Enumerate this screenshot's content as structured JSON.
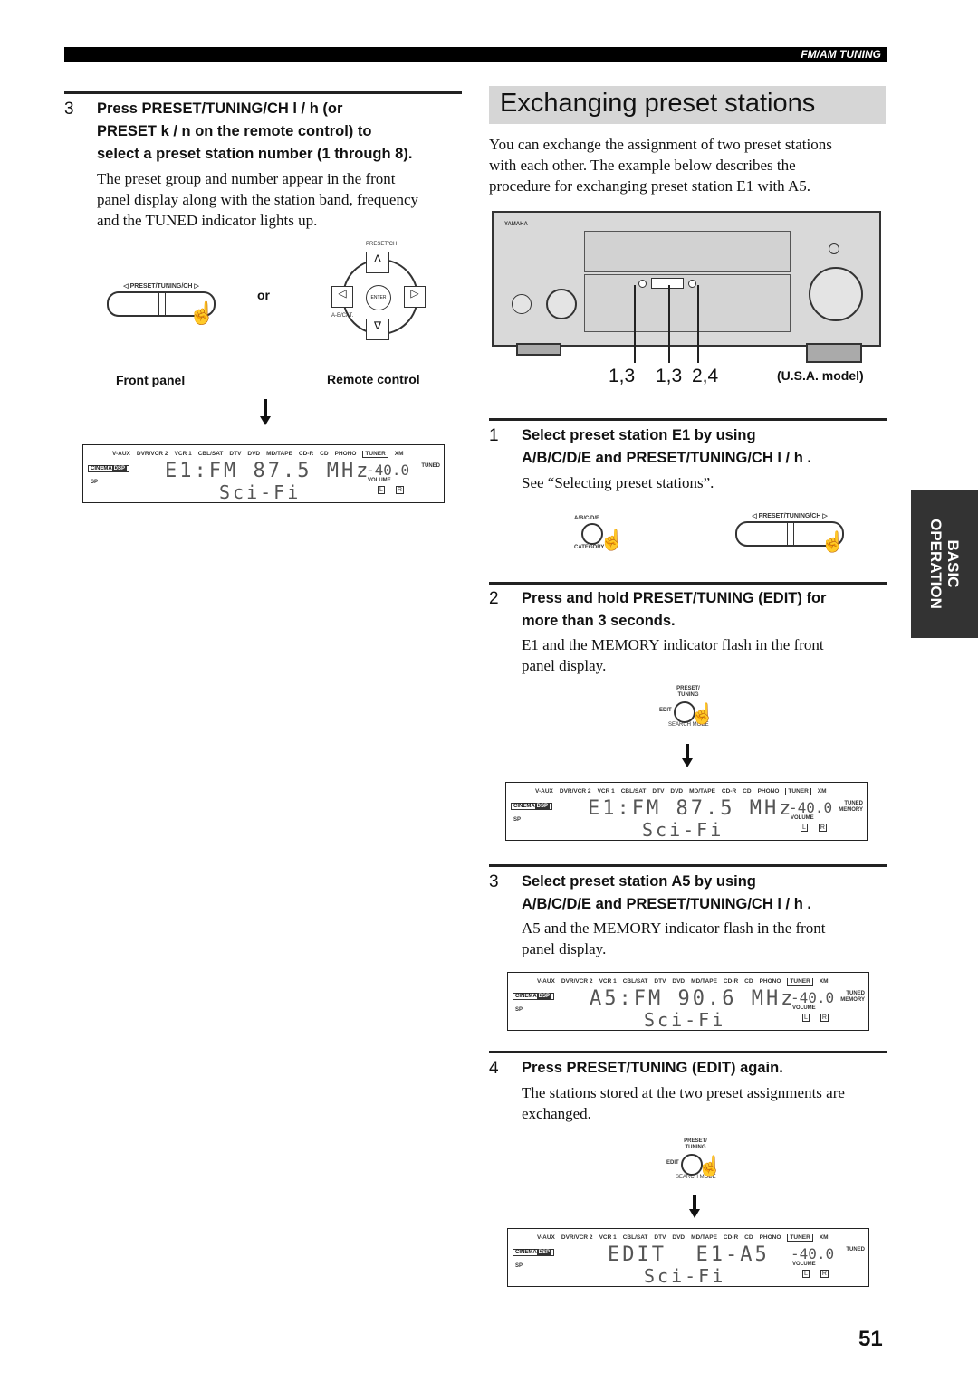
{
  "header": {
    "section": "FM/AM TUNING"
  },
  "left": {
    "step": {
      "number": "3",
      "heading_lines": [
        "Press PRESET/TUNING/CH l  / h  (or",
        "PRESET k / n  on the remote control) to",
        "select a preset station number (1 through 8)."
      ],
      "body_lines": [
        "The preset group and number appear in the front",
        "panel display along with the station band, frequency",
        "and the TUNED indicator lights up."
      ]
    },
    "figure": {
      "front_panel_button": "PRESET/TUNING/CH",
      "or": "or",
      "remote_top_label": "PRESET/CH",
      "remote_center": "ENTER",
      "remote_left_label": "A-E/CAT.",
      "caption_front": "Front panel",
      "caption_remote": "Remote control"
    },
    "display": {
      "inputs": [
        "V-AUX",
        "DVR/VCR 2",
        "VCR 1",
        "CBL/SAT",
        "DTV",
        "DVD",
        "MD/TAPE",
        "CD-R",
        "CD",
        "PHONO",
        "TUNER",
        "XM"
      ],
      "cinema": "CINEMA",
      "dsp": "DSP",
      "line1": "E1:FM 87.5 MHz",
      "line2": "Sci-Fi",
      "volume": "-40.0",
      "volume_label": "VOLUME",
      "status": [
        "TUNED"
      ],
      "sp": "SP",
      "lr": [
        "L",
        "R"
      ]
    }
  },
  "right": {
    "title": "Exchanging preset stations",
    "intro_lines": [
      "You can exchange the assignment of two preset stations",
      "with each other. The example below describes the",
      "procedure for exchanging preset station E1 with A5."
    ],
    "receiver": {
      "brand": "YAMAHA",
      "callouts": [
        "1,3",
        "1,3",
        "2,4"
      ],
      "model_note": "(U.S.A. model)"
    },
    "steps": [
      {
        "number": "1",
        "heading_lines": [
          "Select preset station E1 by using",
          "A/B/C/D/E and PRESET/TUNING/CH l  / h ."
        ],
        "body_lines": [
          "See “Selecting preset stations”."
        ],
        "fig_labels": {
          "abcde": "A/B/C/D/E",
          "category": "CATEGORY",
          "preset": "PRESET/TUNING/CH"
        }
      },
      {
        "number": "2",
        "heading_lines": [
          "Press and hold PRESET/TUNING (EDIT) for",
          "more than 3 seconds."
        ],
        "body_lines": [
          "E1 and the MEMORY indicator flash in the front",
          "panel display."
        ],
        "fig_labels": {
          "preset": "PRESET/",
          "tuning": "TUNING",
          "edit": "EDIT",
          "search": "SEARCH MODE"
        },
        "display": {
          "line1": "E1:FM 87.5 MHz",
          "line2": "Sci-Fi",
          "volume": "-40.0",
          "status": [
            "TUNED",
            "MEMORY"
          ]
        }
      },
      {
        "number": "3",
        "heading_lines": [
          "Select preset station A5 by using",
          "A/B/C/D/E and PRESET/TUNING/CH l  / h ."
        ],
        "body_lines": [
          "A5 and the MEMORY indicator flash in the front",
          "panel display."
        ],
        "display": {
          "line1": "A5:FM 90.6 MHz",
          "line2": "Sci-Fi",
          "volume": "-40.0",
          "status": [
            "TUNED",
            "MEMORY"
          ]
        }
      },
      {
        "number": "4",
        "heading_lines": [
          "Press PRESET/TUNING (EDIT) again."
        ],
        "body_lines": [
          "The stations stored at the two preset assignments are",
          "exchanged."
        ],
        "fig_labels": {
          "preset": "PRESET/",
          "tuning": "TUNING",
          "edit": "EDIT",
          "search": "SEARCH MODE"
        },
        "display": {
          "line1": "EDIT  E1-A5",
          "line2": "Sci-Fi",
          "volume": "-40.0",
          "status": [
            "TUNED"
          ]
        }
      }
    ]
  },
  "side_tab": {
    "line1": "BASIC",
    "line2": "OPERATION"
  },
  "page_number": "51"
}
